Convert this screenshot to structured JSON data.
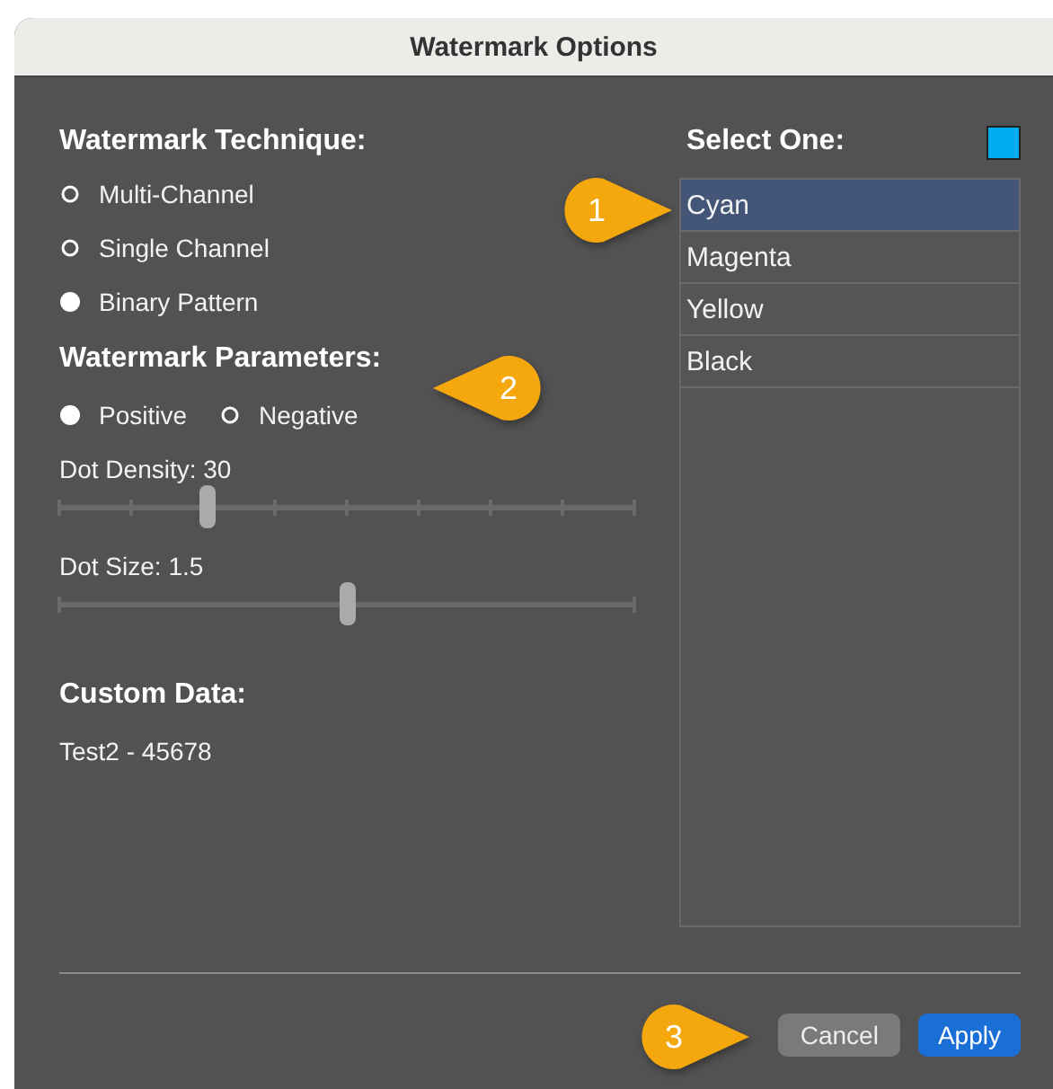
{
  "window": {
    "title": "Watermark Options"
  },
  "technique": {
    "heading": "Watermark Technique:",
    "options": [
      {
        "label": "Multi-Channel",
        "selected": false
      },
      {
        "label": "Single Channel",
        "selected": false
      },
      {
        "label": "Binary Pattern",
        "selected": true
      }
    ]
  },
  "parameters": {
    "heading": "Watermark Parameters:",
    "polarity": [
      {
        "label": "Positive",
        "selected": true
      },
      {
        "label": "Negative",
        "selected": false
      }
    ],
    "sliders": [
      {
        "label": "Dot Density: 30",
        "level": 0.257,
        "kind": "ticked"
      },
      {
        "label": "Dot Size: 1.5",
        "level": 0.5,
        "kind": "plain"
      }
    ]
  },
  "custom_data": {
    "heading": "Custom Data:",
    "value": "Test2 - 45678"
  },
  "channel_list": {
    "heading": "Select One:",
    "items": [
      {
        "label": "Cyan",
        "selected": true
      },
      {
        "label": "Magenta",
        "selected": false
      },
      {
        "label": "Yellow",
        "selected": false
      },
      {
        "label": "Black",
        "selected": false
      }
    ]
  },
  "buttons": [
    {
      "label": "Cancel",
      "kind": "secondary"
    },
    {
      "label": "Apply",
      "kind": "primary"
    }
  ],
  "callouts": [
    {
      "number": "1",
      "kind": "point-right"
    },
    {
      "number": "2",
      "kind": "point-left"
    },
    {
      "number": "3",
      "kind": "point-right"
    }
  ]
}
